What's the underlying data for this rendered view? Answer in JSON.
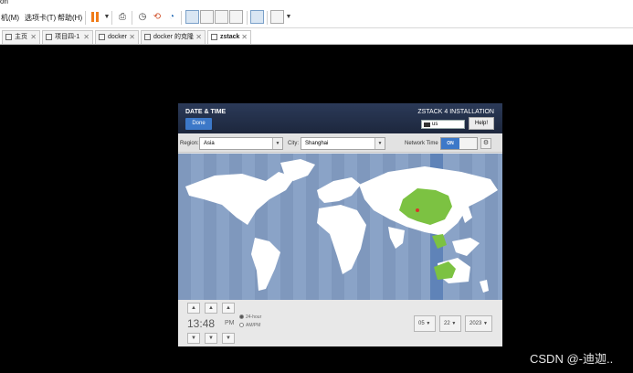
{
  "window": {
    "title_fragment": "on"
  },
  "menu": [
    {
      "label": "机(M)"
    },
    {
      "label": "选项卡(T)"
    },
    {
      "label": "帮助(H)"
    }
  ],
  "tabs": [
    {
      "label": "主页",
      "active": false
    },
    {
      "label": "项目四-1",
      "active": false
    },
    {
      "label": "docker",
      "active": false
    },
    {
      "label": "docker 的克隆",
      "active": false
    },
    {
      "label": "zstack",
      "active": true
    }
  ],
  "installer": {
    "section_title": "DATE & TIME",
    "done_label": "Done",
    "product_title": "ZSTACK 4 INSTALLATION",
    "keyboard_layout": "us",
    "help_label": "Help!",
    "region_label": "Region:",
    "region_value": "Asia",
    "city_label": "City:",
    "city_value": "Shanghai",
    "network_time_label": "Network Time",
    "network_time_state": "ON",
    "time": {
      "hours": "13",
      "minutes": "48",
      "ampm": "PM"
    },
    "format_24": "24-hour",
    "format_12": "AM/PM",
    "date": {
      "month": "05",
      "day": "22",
      "year": "2023"
    }
  },
  "watermark": "CSDN @-迪迦..",
  "colors": {
    "header_bg": "#1f2a44",
    "accent_blue": "#3c78c8",
    "ocean": "#8aa3c7",
    "selected_zone": "#5f83b8",
    "land": "#ffffff",
    "highlighted_country": "#7cc242",
    "pause_orange": "#f07c19"
  }
}
